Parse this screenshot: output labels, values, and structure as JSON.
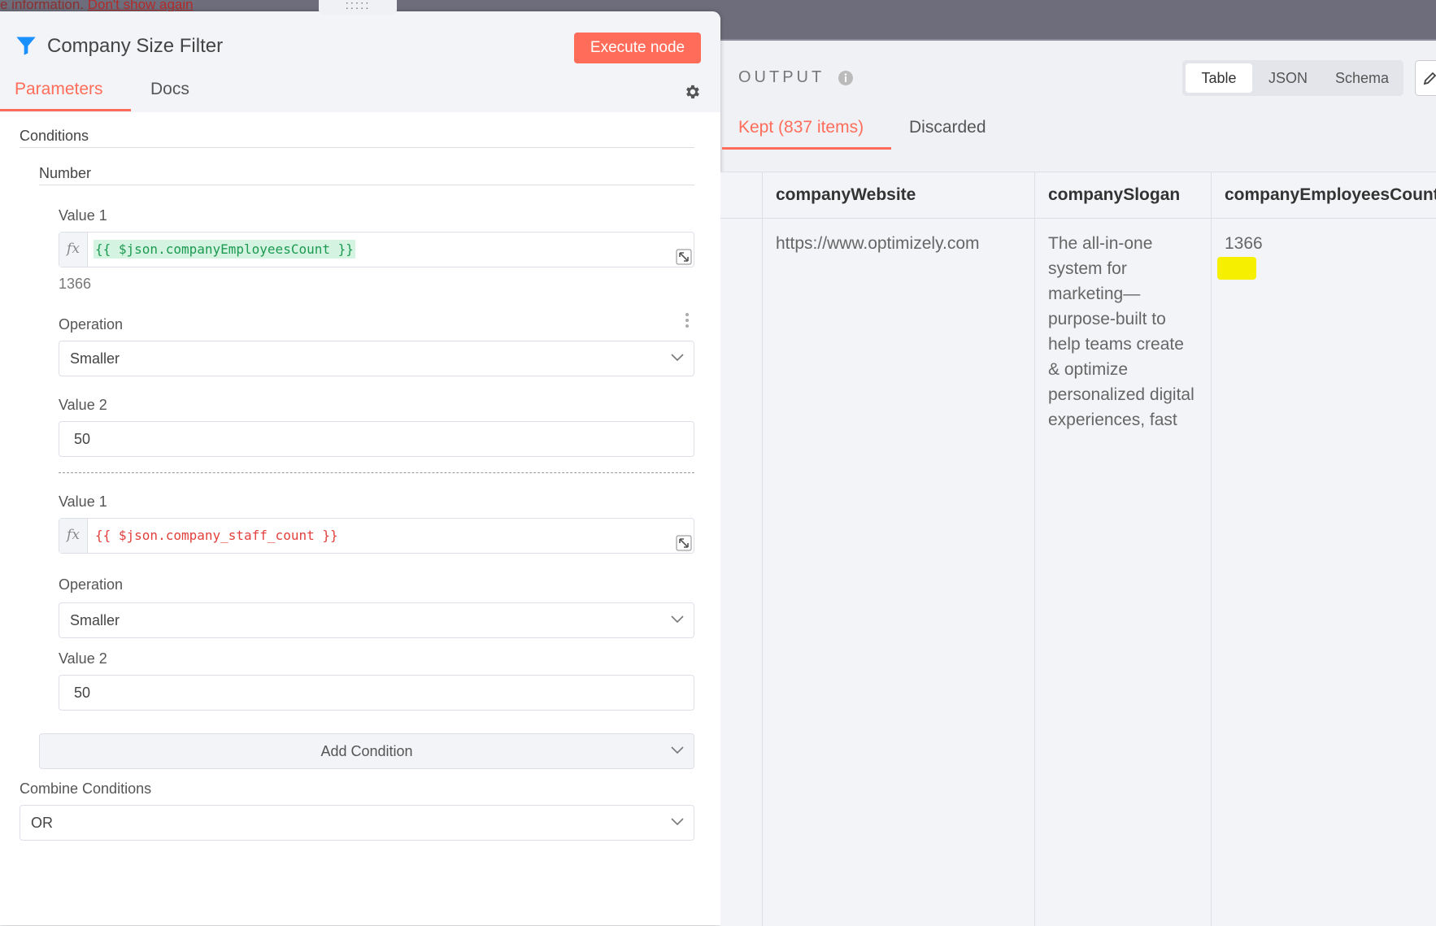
{
  "notice": {
    "text": "e information.",
    "link": "Don't show again"
  },
  "drag_handle": ":::::",
  "node": {
    "title": "Company Size Filter",
    "execute_label": "Execute node",
    "tabs": {
      "parameters": "Parameters",
      "docs": "Docs"
    }
  },
  "params": {
    "conditions_label": "Conditions",
    "number_label": "Number",
    "cond1": {
      "value1_label": "Value 1",
      "value1_expr": "{{ $json.companyEmployeesCount }}",
      "value1_result": "1366",
      "operation_label": "Operation",
      "operation_value": "Smaller",
      "value2_label": "Value 2",
      "value2": "50"
    },
    "cond2": {
      "value1_label": "Value 1",
      "value1_expr": "{{ $json.company_staff_count }}",
      "operation_label": "Operation",
      "operation_value": "Smaller",
      "value2_label": "Value 2",
      "value2": "50"
    },
    "add_condition": "Add Condition",
    "combine_label": "Combine Conditions",
    "combine_value": "OR"
  },
  "output": {
    "label": "OUTPUT",
    "views": {
      "table": "Table",
      "json": "JSON",
      "schema": "Schema"
    },
    "tabs": {
      "kept": "Kept (837 items)",
      "discarded": "Discarded"
    },
    "columns": [
      "companyWebsite",
      "companySlogan",
      "companyEmployeesCount"
    ],
    "row": {
      "website": "https://www.optimizely.com",
      "slogan_lines": [
        "The all-in-one",
        "system for",
        "marketing—",
        "purpose-built to",
        "help teams create",
        "& optimize",
        "personalized digital",
        "experiences, fast"
      ],
      "employees": "1366"
    }
  },
  "colors": {
    "accent": "#ff6d5a",
    "link": "#1a90ff",
    "highlight": "#f6ef00"
  }
}
